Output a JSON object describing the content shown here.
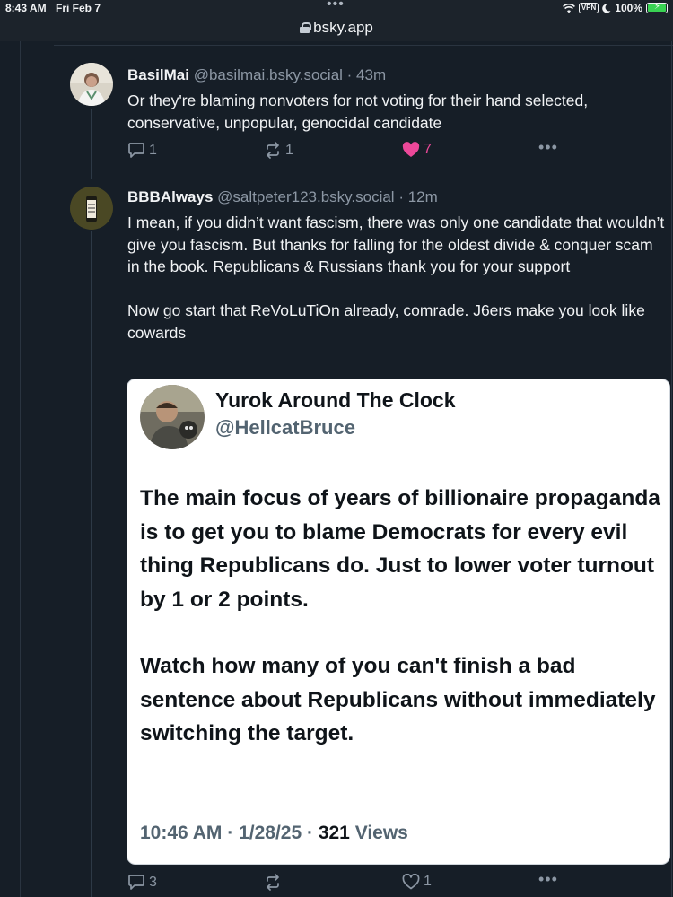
{
  "status_bar": {
    "time": "8:43 AM",
    "date": "Fri Feb 7",
    "vpn_label": "VPN",
    "battery": "100%",
    "url": "bsky.app"
  },
  "posts": [
    {
      "display_name": "BasilMai",
      "handle": "@basilmai.bsky.social",
      "time": "· 43m",
      "text": "Or they're blaming nonvoters for not voting for their hand selected, conservative, unpopular, genocidal candidate",
      "replies": "1",
      "reposts": "1",
      "likes": "7"
    },
    {
      "display_name": "BBBAlways",
      "handle": "@saltpeter123.bsky.social",
      "time": "· 12m",
      "text": "I mean, if you didn’t want fascism, there was only one candidate that wouldn’t give you fascism. But thanks for falling for the oldest divide & conquer scam in the book. Republicans & Russians thank you for your support\n\nNow go start that ReVoLuTiOn already, comrade. J6ers make you look like cowards",
      "replies": "3",
      "reposts": "",
      "likes": "1",
      "embed": {
        "name": "Yurok Around The Clock",
        "handle": "@HellcatBruce",
        "paragraph1": "The main focus of years of billionaire propaganda is to get you to blame Democrats for every evil thing Republicans do. Just to lower voter turnout by 1 or 2 points.",
        "paragraph2": "Watch how many of you can't finish a bad sentence about Republicans without immediately switching the target.",
        "meta": "10:46 AM · 1/28/25 · ",
        "views_count": "321",
        "views_label": " Views"
      }
    }
  ],
  "colors": {
    "background": "#161e27",
    "like_accent": "#ec4899",
    "muted_text": "#8c97a4"
  }
}
